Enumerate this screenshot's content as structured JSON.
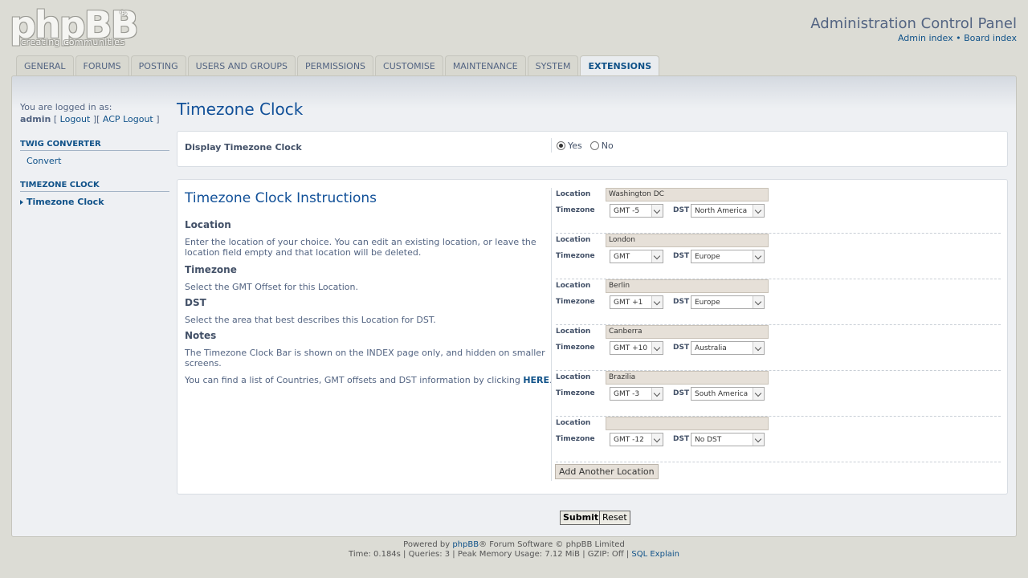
{
  "header": {
    "logo_text": "phpBB",
    "logo_reg": "®",
    "logo_tagline": "creating  communities",
    "acp_title": "Administration Control Panel",
    "admin_index": "Admin index",
    "separator": " • ",
    "board_index": "Board index"
  },
  "tabs": [
    {
      "label": "General"
    },
    {
      "label": "Forums"
    },
    {
      "label": "Posting"
    },
    {
      "label": "Users and Groups"
    },
    {
      "label": "Permissions"
    },
    {
      "label": "Customise"
    },
    {
      "label": "Maintenance"
    },
    {
      "label": "System"
    },
    {
      "label": "Extensions"
    }
  ],
  "sidebar": {
    "logged_in_as": "You are logged in as:",
    "username": "admin",
    "logout": "Logout",
    "acp_logout": "ACP Logout",
    "section1": "Twig Converter",
    "section1_item": "Convert",
    "section2": "Timezone Clock",
    "section2_item": "Timezone Clock"
  },
  "page": {
    "title": "Timezone Clock",
    "display_label": "Display Timezone Clock",
    "yes": "Yes",
    "no": "No",
    "display_selected": "Yes"
  },
  "instructions": {
    "title": "Timezone Clock Instructions",
    "location_h": "Location",
    "location_text": "Enter the location of your choice. You can edit an existing location, or leave the location field empty and that location will be deleted.",
    "timezone_h": "Timezone",
    "timezone_text": "Select the GMT Offset for this Location.",
    "dst_h": "DST",
    "dst_text": "Select the area that best describes this Location for DST.",
    "notes_h": "Notes",
    "notes_text": "The Timezone Clock Bar is shown on the INDEX page only, and hidden on smaller screens.",
    "find_text": "You can find a list of Countries, GMT offsets and DST information by clicking ",
    "here": "HERE",
    "period": "."
  },
  "location_form": {
    "location_label": "Location",
    "timezone_label": "Timezone",
    "dst_label": "DST",
    "entries": [
      {
        "location": "Washington DC",
        "timezone": "GMT -5",
        "dst": "North America"
      },
      {
        "location": "London",
        "timezone": "GMT",
        "dst": "Europe"
      },
      {
        "location": "Berlin",
        "timezone": "GMT +1",
        "dst": "Europe"
      },
      {
        "location": "Canberra",
        "timezone": "GMT +10",
        "dst": "Australia"
      },
      {
        "location": "Brazilia",
        "timezone": "GMT -3",
        "dst": "South America"
      },
      {
        "location": "",
        "timezone": "GMT -12",
        "dst": "No DST"
      }
    ],
    "add_button": "Add Another Location"
  },
  "actions": {
    "submit": "Submit",
    "reset": "Reset"
  },
  "footer": {
    "powered_prefix": "Powered by ",
    "phpbb": "phpBB",
    "powered_suffix": "® Forum Software © phpBB Limited",
    "stats": "Time: 0.184s | Queries: 3 | Peak Memory Usage: 7.12 MiB | GZIP: Off | ",
    "sql_explain": "SQL Explain"
  },
  "colors": {
    "background": "#dcdcd5",
    "link": "#105289",
    "title": "#115098"
  }
}
